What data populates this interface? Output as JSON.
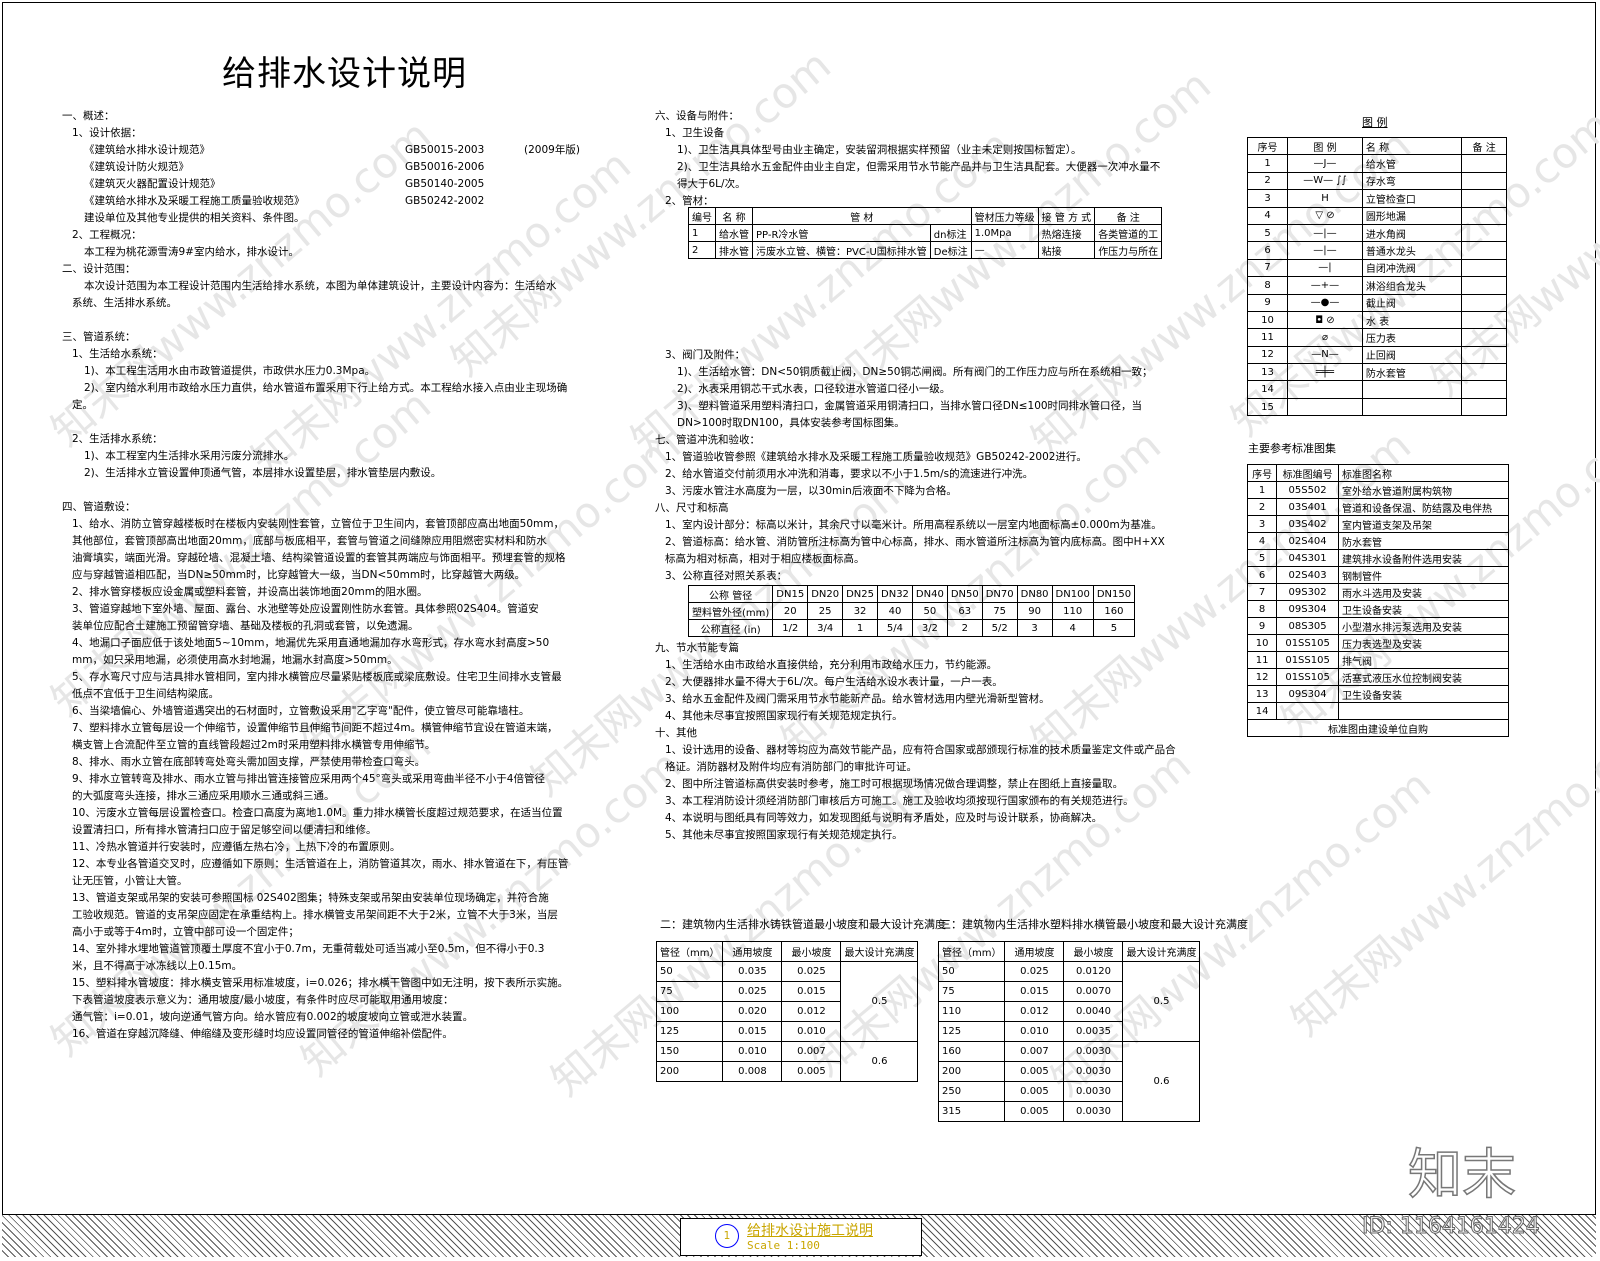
{
  "title": "给排水设计说明",
  "left_col": [
    {
      "t": "一、概述：",
      "i": 0
    },
    {
      "t": "1、设计依据：",
      "i": 1
    },
    {
      "t": "《建筑给水排水设计规范》",
      "i": 2,
      "code": "GB50015-2003",
      "extra": "(2009年版)"
    },
    {
      "t": "《建筑设计防火规范》",
      "i": 2,
      "code": "GB50016-2006"
    },
    {
      "t": "《建筑灭火器配置设计规范》",
      "i": 2,
      "code": "GB50140-2005"
    },
    {
      "t": "《建筑给水排水及采暖工程施工质量验收规范》",
      "i": 2,
      "code": "GB50242-2002"
    },
    {
      "t": "建设单位及其他专业提供的相关资料、条件图。",
      "i": 2
    },
    {
      "t": "2、工程概况：",
      "i": 1
    },
    {
      "t": "本工程为桃花源雪涛9#室内给水，排水设计。",
      "i": 2
    },
    {
      "t": "二、设计范围：",
      "i": 0
    },
    {
      "t": "本次设计范围为本工程设计范围内生活给排水系统，本图为单体建筑设计，主要设计内容为：生活给水",
      "i": 2
    },
    {
      "t": "系统、生活排水系统。",
      "i": 1
    },
    {
      "t": "",
      "i": 0
    },
    {
      "t": "三、管道系统：",
      "i": 0
    },
    {
      "t": "1、生活给水系统：",
      "i": 1
    },
    {
      "t": "1)、本工程生活用水由市政管道提供，市政供水压力0.3Mpa。",
      "i": 2
    },
    {
      "t": "2)、室内给水利用市政给水压力直供，给水管道布置采用下行上给方式。本工程给水接入点由业主现场确",
      "i": 2
    },
    {
      "t": "定。",
      "i": 1
    },
    {
      "t": "",
      "i": 0
    },
    {
      "t": "2、生活排水系统：",
      "i": 1
    },
    {
      "t": "1)、本工程室内生活排水采用污废分流排水。",
      "i": 2
    },
    {
      "t": "2)、生活排水立管设置伸顶通气管，本层排水设置垫层，排水管垫层内敷设。",
      "i": 2
    },
    {
      "t": "",
      "i": 0
    },
    {
      "t": "四、管道敷设：",
      "i": 0
    },
    {
      "t": "1、给水、消防立管穿越楼板时在楼板内安装刚性套管，立管位于卫生间内，套管顶部应高出地面50mm，",
      "i": 1
    },
    {
      "t": "其他部位，套管顶部高出地面20mm，底部与板底相平，套管与管道之间缝隙应用阻燃密实材料和防水",
      "i": 1
    },
    {
      "t": "油膏填实，端面光滑。穿越砼墙、混凝土墙、结构梁管道设置的套管其两端应与饰面相平。预埋套管的规格",
      "i": 1
    },
    {
      "t": "应与穿越管道相匹配，当DN≥50mm时，比穿越管大一级，当DN<50mm时，比穿越管大两级。",
      "i": 1
    },
    {
      "t": "2、排水管穿楼板应设金属或塑料套管，并设高出装饰地面20mm的阻水圈。",
      "i": 1
    },
    {
      "t": "3、管道穿越地下室外墙、屋面、露台、水池壁等处应设置刚性防水套管。具体参照02S404。管道安",
      "i": 1
    },
    {
      "t": "装单位应配合土建施工预留管穿墙、基础及楼板的孔洞或套管，以免遗漏。",
      "i": 1
    },
    {
      "t": "4、地漏口子面应低于该处地面5~10mm，地漏优先采用直通地漏加存水弯形式，存水弯水封高度>50",
      "i": 1
    },
    {
      "t": "mm，如只采用地漏，必须使用高水封地漏，地漏水封高度>50mm。",
      "i": 1
    },
    {
      "t": "5、存水弯尺寸应与洁具排水管相同，室内排水横管应尽量紧贴楼板底或梁底敷设。住宅卫生间排水支管最",
      "i": 1
    },
    {
      "t": "低点不宜低于卫生间结构梁底。",
      "i": 1
    },
    {
      "t": "6、当梁墙偏心、外墙管道遇突出的石材面时，立管敷设采用\"乙字弯\"配件，使立管尽可能靠墙柱。",
      "i": 1
    },
    {
      "t": "7、塑料排水立管每层设一个伸缩节，设置伸缩节且伸缩节间距不超过4m。横管伸缩节宜设在管道末端，",
      "i": 1
    },
    {
      "t": "横支管上合流配件至立管的直线管段超过2m时采用塑料排水横管专用伸缩节。",
      "i": 1
    },
    {
      "t": "8、排水、雨水立管在底部转弯处弯头需加固支撑，严禁使用带检查口弯头。",
      "i": 1
    },
    {
      "t": "9、排水立管转弯及排水、雨水立管与排出管连接管应采用两个45°弯头或采用弯曲半径不小于4倍管径",
      "i": 1
    },
    {
      "t": "的大弧度弯头连接，排水三通应采用顺水三通或斜三通。",
      "i": 1
    },
    {
      "t": "10、污废水立管每层设置检查口。检查口高度为离地1.0M。重力排水横管长度超过规范要求，在适当位置",
      "i": 1
    },
    {
      "t": "设置清扫口，所有排水管清扫口应于留足够空间以便清扫和维修。",
      "i": 1
    },
    {
      "t": "11、冷热水管道并行安装时，应遵循左热右冷，上热下冷的布置原则。",
      "i": 1
    },
    {
      "t": "12、本专业各管道交叉时，应遵循如下原则：生活管道在上，消防管道其次，雨水、排水管道在下，有压管",
      "i": 1
    },
    {
      "t": "让无压管，小管让大管。",
      "i": 1
    },
    {
      "t": "13、管道支架或吊架的安装可参照国标 02S402图集；特殊支架或吊架由安装单位现场确定，并符合施",
      "i": 1
    },
    {
      "t": "工验收规范。管道的支吊架应固定在承重结构上。排水横管支吊架间距不大于2米，立管不大于3米，当层",
      "i": 1
    },
    {
      "t": "高小于或等于4m时，立管中部可设一个固定件；",
      "i": 1
    },
    {
      "t": "14、室外排水埋地管道管顶覆土厚度不宜小于0.7m，无重荷载处可适当减小至0.5m，但不得小于0.3",
      "i": 1
    },
    {
      "t": "米，且不得高于冰冻线以上0.15m。",
      "i": 1
    },
    {
      "t": "15、塑料排水管坡度：排水横支管采用标准坡度，i=0.026；排水横干管图中如无注明，按下表所示实施。",
      "i": 1
    },
    {
      "t": "下表管道坡度表示意义为：通用坡度/最小坡度，有条件时应尽可能取用通用坡度：",
      "i": 1
    },
    {
      "t": "通气管：i=0.01，坡向逆通气管方向。给水管应有0.002的坡度坡向立管或泄水装置。",
      "i": 1
    },
    {
      "t": "16、管道在穿越沉降缝、伸缩缝及变形缝时均应设置同管径的管道伸缩补偿配件。",
      "i": 1
    }
  ],
  "mid_top": [
    {
      "t": "六、设备与附件：",
      "i": 0
    },
    {
      "t": "1、卫生设备",
      "i": 1
    },
    {
      "t": "1)、卫生洁具具体型号由业主确定，安装留洞根据实样预留（业主未定则按国标暂定）。",
      "i": 2
    },
    {
      "t": "2)、卫生洁具给水五金配件由业主自定，但需采用节水节能产品并与卫生洁具配套。大便器一次冲水量不",
      "i": 2
    },
    {
      "t": "得大于6L/次。",
      "i": 2
    },
    {
      "t": "2、管材：",
      "i": 1
    }
  ],
  "pipe_table": {
    "headers": [
      "编号",
      "名 称",
      "管  材",
      "管材压力等级",
      "接 管 方 式",
      "备 注"
    ],
    "rows": [
      [
        "1",
        "给水管",
        "PP-R冷水管",
        "dn标注",
        "1.0Mpa",
        "热熔连接",
        "各类管道的工"
      ],
      [
        "2",
        "排水管",
        "污废水立管、横管：PVC-U国标排水管",
        "De标注",
        "—",
        "粘接",
        "作压力与所在"
      ]
    ]
  },
  "mid_mid": [
    {
      "t": "3、阀门及附件：",
      "i": 1
    },
    {
      "t": "1)、生活给水管：DN<50铜质截止阀，DN≥50铜芯闸阀。所有阀门的工作压力应与所在系统相一致；",
      "i": 2
    },
    {
      "t": "2)、水表采用铜芯干式水表，口径较进水管道口径小一级。",
      "i": 2
    },
    {
      "t": "3)、塑料管道采用塑料清扫口，金属管道采用铜清扫口，当排水管口径DN≤100时同排水管口径，当",
      "i": 2
    },
    {
      "t": "DN>100时取DN100，具体安装参考国标图集。",
      "i": 2
    },
    {
      "t": "七、管道冲洗和验收：",
      "i": 0
    },
    {
      "t": "1、管道验收管参照《建筑给水排水及采暖工程施工质量验收规范》GB50242-2002进行。",
      "i": 1
    },
    {
      "t": "2、给水管道交付前须用水冲洗和消毒，要求以不小于1.5m/s的流速进行冲洗。",
      "i": 1
    },
    {
      "t": "3、污废水管注水高度为一层，以30min后液面不下降为合格。",
      "i": 1
    },
    {
      "t": "八、尺寸和标高",
      "i": 0
    },
    {
      "t": "1、室内设计部分：标高以米计，其余尺寸以毫米计。所用高程系统以一层室内地面标高±0.000m为基准。",
      "i": 1
    },
    {
      "t": "2、管道标高：给水管、消防管所注标高为管中心标高，排水、雨水管道所注标高为管内底标高。图中H+XX",
      "i": 1
    },
    {
      "t": "标高为相对标高，相对于相应楼板面标高。",
      "i": 1
    },
    {
      "t": "3、公称直径对照关系表：",
      "i": 1
    }
  ],
  "dn_table": {
    "rows": [
      [
        "公称 管径",
        "DN15",
        "DN20",
        "DN25",
        "DN32",
        "DN40",
        "DN50",
        "DN70",
        "DN80",
        "DN100",
        "DN150"
      ],
      [
        "塑料管外径(mm)",
        "20",
        "25",
        "32",
        "40",
        "50",
        "63",
        "75",
        "90",
        "110",
        "160"
      ],
      [
        "公称直径 (in)",
        "1/2",
        "3/4",
        "1",
        "5/4",
        "3/2",
        "2",
        "5/2",
        "3",
        "4",
        "5"
      ]
    ]
  },
  "mid_bot": [
    {
      "t": "九、节水节能专篇",
      "i": 0
    },
    {
      "t": "1、生活给水由市政给水直接供给，充分利用市政给水压力，节约能源。",
      "i": 1
    },
    {
      "t": "2、大便器排水量不得大于6L/次。每户生活给水设水表计量，一户一表。",
      "i": 1
    },
    {
      "t": "3、给水五金配件及阀门需采用节水节能新产品。给水管材选用内壁光滑新型管材。",
      "i": 1
    },
    {
      "t": "4、其他未尽事宜按照国家现行有关规范规定执行。",
      "i": 1
    },
    {
      "t": "十、其他",
      "i": 0
    },
    {
      "t": "1、设计选用的设备、器材等均应为高效节能产品，应有符合国家或部颁现行标准的技术质量鉴定文件或产品合",
      "i": 1
    },
    {
      "t": "格证。消防器材及附件均应有消防部门的审批许可证。",
      "i": 1
    },
    {
      "t": "2、图中所注管道标高供安装时参考，施工时可根据现场情况做合理调整，禁止在图纸上直接量取。",
      "i": 1
    },
    {
      "t": "3、本工程消防设计须经消防部门审核后方可施工。施工及验收均须按现行国家颁布的有关规范进行。",
      "i": 1
    },
    {
      "t": "4、本说明与图纸具有同等效力，如发现图纸与说明有矛盾处，应及时与设计联系，协商解决。",
      "i": 1
    },
    {
      "t": "5、其他未尽事宜按照国家现行有关规范规定执行。",
      "i": 1
    }
  ],
  "legend": {
    "title": "图 例",
    "headers": [
      "序号",
      "图 例",
      "名 称",
      "备 注"
    ],
    "rows": [
      [
        "1",
        "—J—",
        "给水管"
      ],
      [
        "2",
        "—W— ∫∫",
        "存水弯"
      ],
      [
        "3",
        "H",
        "立管检查口"
      ],
      [
        "4",
        "▽ ⊘",
        "圆形地漏"
      ],
      [
        "5",
        "—|—",
        "进水角阀"
      ],
      [
        "6",
        "—|—",
        "普通水龙头"
      ],
      [
        "7",
        "—|",
        "自闭冲洗阀"
      ],
      [
        "8",
        "—+—",
        "淋浴组合龙头"
      ],
      [
        "9",
        "—●—",
        "截止阀"
      ],
      [
        "10",
        "◘ ⊘",
        "水 表"
      ],
      [
        "11",
        "⌀",
        "压力表"
      ],
      [
        "12",
        "—N—",
        "止回阀"
      ],
      [
        "13",
        "═╪═",
        "防水套管"
      ],
      [
        "14",
        "",
        ""
      ],
      [
        "15",
        "",
        ""
      ]
    ]
  },
  "std": {
    "title": "主要参考标准图集",
    "headers": [
      "序号",
      "标准图编号",
      "标准图名称"
    ],
    "rows": [
      [
        "1",
        "05S502",
        "室外给水管道附属构筑物"
      ],
      [
        "2",
        "03S401",
        "管道和设备保温、防结露及电伴热"
      ],
      [
        "3",
        "03S402",
        "室内管道支架及吊架"
      ],
      [
        "4",
        "02S404",
        "防水套管"
      ],
      [
        "5",
        "04S301",
        "建筑排水设备附件选用安装"
      ],
      [
        "6",
        "02S403",
        "钢制管件"
      ],
      [
        "7",
        "09S302",
        "雨水斗选用及安装"
      ],
      [
        "8",
        "09S304",
        "卫生设备安装"
      ],
      [
        "9",
        "08S305",
        "小型潜水排污泵选用及安装"
      ],
      [
        "10",
        "01SS105",
        "压力表选型及安装"
      ],
      [
        "11",
        "01SS105",
        "排气阀"
      ],
      [
        "12",
        "01SS105",
        "活塞式液压水位控制阀安装"
      ],
      [
        "13",
        "09S304",
        "卫生设备安装"
      ],
      [
        "14",
        "",
        ""
      ]
    ],
    "footer": "标准图由建设单位自购"
  },
  "slope1": {
    "title": "二：建筑物内生活排水铸铁管道最小坡度和最大设计充满度",
    "headers": [
      "管径（mm）",
      "通用坡度",
      "最小坡度",
      "最大设计充满度"
    ],
    "rows": [
      [
        "50",
        "0.035",
        "0.025"
      ],
      [
        "75",
        "0.025",
        "0.015"
      ],
      [
        "100",
        "0.020",
        "0.012"
      ],
      [
        "125",
        "0.015",
        "0.010"
      ],
      [
        "150",
        "0.010",
        "0.007"
      ],
      [
        "200",
        "0.008",
        "0.005"
      ]
    ],
    "fill": [
      "0.5",
      "0.6"
    ]
  },
  "slope2": {
    "title": "三：建筑物内生活排水塑料排水横管最小坡度和最大设计充满度",
    "headers": [
      "管径（mm）",
      "通用坡度",
      "最小坡度",
      "最大设计充满度"
    ],
    "rows": [
      [
        "50",
        "0.025",
        "0.0120"
      ],
      [
        "75",
        "0.015",
        "0.0070"
      ],
      [
        "110",
        "0.012",
        "0.0040"
      ],
      [
        "125",
        "0.010",
        "0.0035"
      ],
      [
        "160",
        "0.007",
        "0.0030"
      ],
      [
        "200",
        "0.005",
        "0.0030"
      ],
      [
        "250",
        "0.005",
        "0.0030"
      ],
      [
        "315",
        "0.005",
        "0.0030"
      ]
    ],
    "fill": [
      "0.5",
      "0.6"
    ]
  },
  "title_block": {
    "num": "1",
    "name": "给排水设计施工说明",
    "scale": "Scale  1:100"
  },
  "logo": "知末",
  "id_text": "ID: 1164161424",
  "watermark": "知末网www.znzmo.com"
}
